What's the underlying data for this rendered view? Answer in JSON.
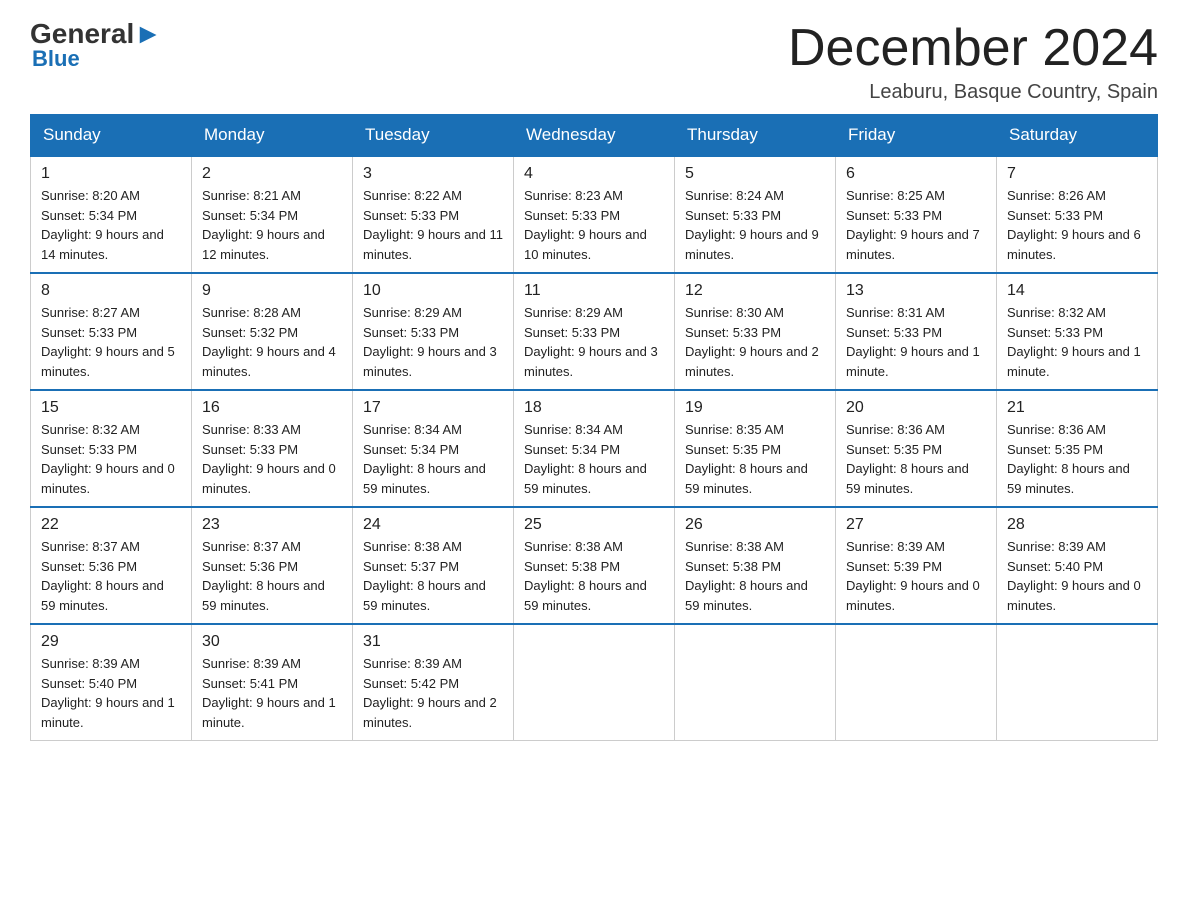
{
  "header": {
    "logo_main": "General",
    "logo_blue": "Blue",
    "month_title": "December 2024",
    "location": "Leaburu, Basque Country, Spain"
  },
  "days_of_week": [
    "Sunday",
    "Monday",
    "Tuesday",
    "Wednesday",
    "Thursday",
    "Friday",
    "Saturday"
  ],
  "weeks": [
    [
      {
        "day": "1",
        "sunrise": "8:20 AM",
        "sunset": "5:34 PM",
        "daylight": "9 hours and 14 minutes."
      },
      {
        "day": "2",
        "sunrise": "8:21 AM",
        "sunset": "5:34 PM",
        "daylight": "9 hours and 12 minutes."
      },
      {
        "day": "3",
        "sunrise": "8:22 AM",
        "sunset": "5:33 PM",
        "daylight": "9 hours and 11 minutes."
      },
      {
        "day": "4",
        "sunrise": "8:23 AM",
        "sunset": "5:33 PM",
        "daylight": "9 hours and 10 minutes."
      },
      {
        "day": "5",
        "sunrise": "8:24 AM",
        "sunset": "5:33 PM",
        "daylight": "9 hours and 9 minutes."
      },
      {
        "day": "6",
        "sunrise": "8:25 AM",
        "sunset": "5:33 PM",
        "daylight": "9 hours and 7 minutes."
      },
      {
        "day": "7",
        "sunrise": "8:26 AM",
        "sunset": "5:33 PM",
        "daylight": "9 hours and 6 minutes."
      }
    ],
    [
      {
        "day": "8",
        "sunrise": "8:27 AM",
        "sunset": "5:33 PM",
        "daylight": "9 hours and 5 minutes."
      },
      {
        "day": "9",
        "sunrise": "8:28 AM",
        "sunset": "5:32 PM",
        "daylight": "9 hours and 4 minutes."
      },
      {
        "day": "10",
        "sunrise": "8:29 AM",
        "sunset": "5:33 PM",
        "daylight": "9 hours and 3 minutes."
      },
      {
        "day": "11",
        "sunrise": "8:29 AM",
        "sunset": "5:33 PM",
        "daylight": "9 hours and 3 minutes."
      },
      {
        "day": "12",
        "sunrise": "8:30 AM",
        "sunset": "5:33 PM",
        "daylight": "9 hours and 2 minutes."
      },
      {
        "day": "13",
        "sunrise": "8:31 AM",
        "sunset": "5:33 PM",
        "daylight": "9 hours and 1 minute."
      },
      {
        "day": "14",
        "sunrise": "8:32 AM",
        "sunset": "5:33 PM",
        "daylight": "9 hours and 1 minute."
      }
    ],
    [
      {
        "day": "15",
        "sunrise": "8:32 AM",
        "sunset": "5:33 PM",
        "daylight": "9 hours and 0 minutes."
      },
      {
        "day": "16",
        "sunrise": "8:33 AM",
        "sunset": "5:33 PM",
        "daylight": "9 hours and 0 minutes."
      },
      {
        "day": "17",
        "sunrise": "8:34 AM",
        "sunset": "5:34 PM",
        "daylight": "8 hours and 59 minutes."
      },
      {
        "day": "18",
        "sunrise": "8:34 AM",
        "sunset": "5:34 PM",
        "daylight": "8 hours and 59 minutes."
      },
      {
        "day": "19",
        "sunrise": "8:35 AM",
        "sunset": "5:35 PM",
        "daylight": "8 hours and 59 minutes."
      },
      {
        "day": "20",
        "sunrise": "8:36 AM",
        "sunset": "5:35 PM",
        "daylight": "8 hours and 59 minutes."
      },
      {
        "day": "21",
        "sunrise": "8:36 AM",
        "sunset": "5:35 PM",
        "daylight": "8 hours and 59 minutes."
      }
    ],
    [
      {
        "day": "22",
        "sunrise": "8:37 AM",
        "sunset": "5:36 PM",
        "daylight": "8 hours and 59 minutes."
      },
      {
        "day": "23",
        "sunrise": "8:37 AM",
        "sunset": "5:36 PM",
        "daylight": "8 hours and 59 minutes."
      },
      {
        "day": "24",
        "sunrise": "8:38 AM",
        "sunset": "5:37 PM",
        "daylight": "8 hours and 59 minutes."
      },
      {
        "day": "25",
        "sunrise": "8:38 AM",
        "sunset": "5:38 PM",
        "daylight": "8 hours and 59 minutes."
      },
      {
        "day": "26",
        "sunrise": "8:38 AM",
        "sunset": "5:38 PM",
        "daylight": "8 hours and 59 minutes."
      },
      {
        "day": "27",
        "sunrise": "8:39 AM",
        "sunset": "5:39 PM",
        "daylight": "9 hours and 0 minutes."
      },
      {
        "day": "28",
        "sunrise": "8:39 AM",
        "sunset": "5:40 PM",
        "daylight": "9 hours and 0 minutes."
      }
    ],
    [
      {
        "day": "29",
        "sunrise": "8:39 AM",
        "sunset": "5:40 PM",
        "daylight": "9 hours and 1 minute."
      },
      {
        "day": "30",
        "sunrise": "8:39 AM",
        "sunset": "5:41 PM",
        "daylight": "9 hours and 1 minute."
      },
      {
        "day": "31",
        "sunrise": "8:39 AM",
        "sunset": "5:42 PM",
        "daylight": "9 hours and 2 minutes."
      },
      null,
      null,
      null,
      null
    ]
  ],
  "labels": {
    "sunrise": "Sunrise:",
    "sunset": "Sunset:",
    "daylight": "Daylight:"
  }
}
